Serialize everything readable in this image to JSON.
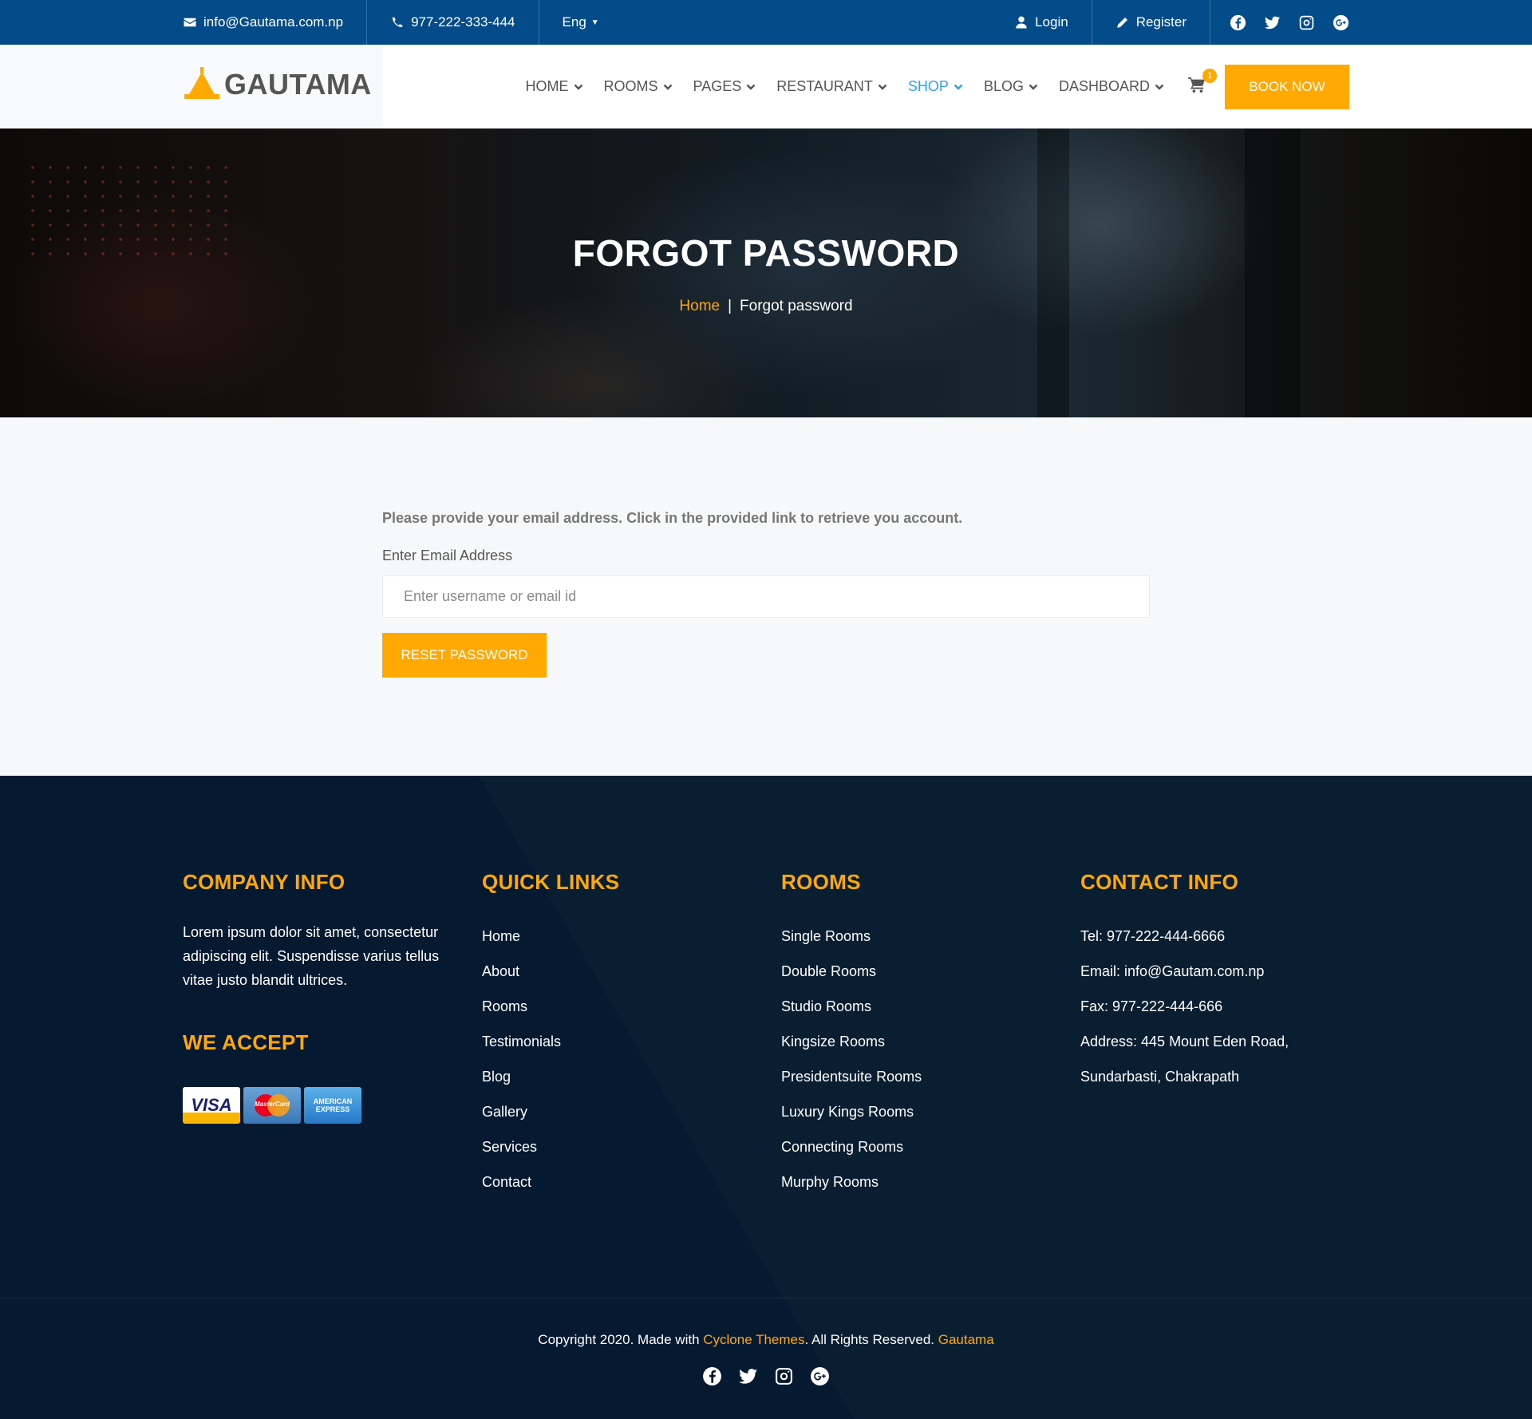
{
  "topbar": {
    "email": "info@Gautama.com.np",
    "phone": "977-222-333-444",
    "language": "Eng",
    "login": "Login",
    "register": "Register",
    "social_icons": [
      "facebook-icon",
      "twitter-icon",
      "instagram-icon",
      "google-plus-icon"
    ]
  },
  "header": {
    "logo_text": "GAUTAMA",
    "nav": [
      {
        "label": "HOME"
      },
      {
        "label": "ROOMS"
      },
      {
        "label": "PAGES"
      },
      {
        "label": "RESTAURANT"
      },
      {
        "label": "SHOP",
        "active": true
      },
      {
        "label": "BLOG"
      },
      {
        "label": "DASHBOARD"
      }
    ],
    "cart_count": "1",
    "book_now": "BOOK NOW"
  },
  "banner": {
    "title": "FORGOT PASSWORD",
    "breadcrumb_home": "Home",
    "breadcrumb_sep": "|",
    "breadcrumb_current": "Forgot password"
  },
  "form": {
    "instruction": "Please provide your email address. Click in the provided link to retrieve you account.",
    "label": "Enter Email Address",
    "value": "",
    "placeholder": "Enter username or email id",
    "button": "RESET PASSWORD"
  },
  "footer": {
    "company": {
      "title": "COMPANY INFO",
      "text": "Lorem ipsum dolor sit amet, consectetur adipiscing elit. Suspendisse varius tellus vitae justo blandit ultrices.",
      "accept_title": "WE ACCEPT",
      "cards": {
        "visa": "VISA",
        "mastercard": "MasterCard",
        "amex_line1": "AMERICAN",
        "amex_line2": "EXPRESS"
      }
    },
    "quick_links": {
      "title": "QUICK LINKS",
      "items": [
        "Home",
        "About",
        "Rooms",
        "Testimonials",
        "Blog",
        "Gallery",
        "Services",
        "Contact"
      ]
    },
    "rooms": {
      "title": "ROOMS",
      "items": [
        "Single Rooms",
        "Double Rooms",
        "Studio Rooms",
        "Kingsize Rooms",
        "Presidentsuite Rooms",
        "Luxury Kings Rooms",
        "Connecting Rooms",
        "Murphy Rooms"
      ]
    },
    "contact": {
      "title": "CONTACT INFO",
      "items": [
        "Tel: 977-222-444-6666",
        "Email: info@Gautam.com.np",
        "Fax: 977-222-444-666",
        "Address: 445 Mount Eden Road,",
        "Sundarbasti, Chakrapath"
      ]
    },
    "copyright": {
      "prefix": "Copyright 2020. Made with ",
      "brand": "Cyclone Themes",
      "middle": ". All Rights Reserved. ",
      "site": "Gautama"
    }
  },
  "colors": {
    "topbar": "#044c89",
    "accent": "#ffa902",
    "active_nav": "#2ea3f2",
    "footer": "#051a30"
  }
}
